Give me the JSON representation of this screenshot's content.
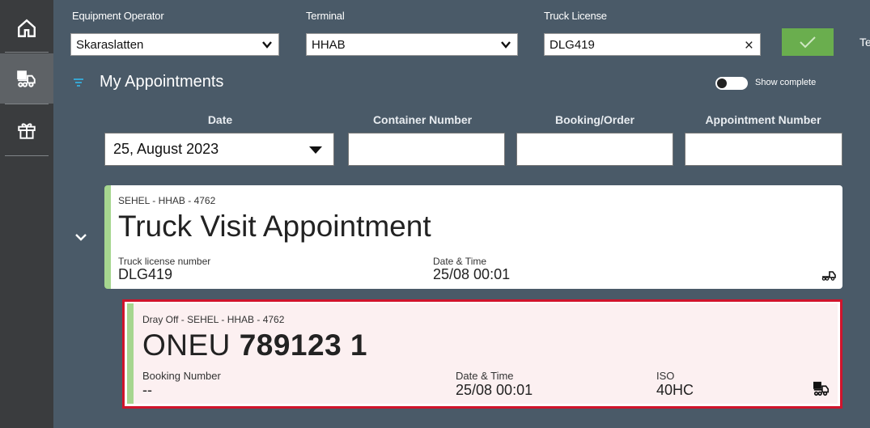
{
  "sidebar": {
    "items": [
      {
        "icon": "home-icon"
      },
      {
        "icon": "truck-loader-icon",
        "active": true
      },
      {
        "icon": "gift-icon"
      }
    ]
  },
  "filters": {
    "operator_label": "Equipment Operator",
    "operator_value": "Skaraslatten",
    "terminal_label": "Terminal",
    "terminal_value": "HHAB",
    "license_label": "Truck License",
    "license_value": "DLG419",
    "clear_symbol": "×",
    "truncated_text": "Te"
  },
  "appointments": {
    "title": "My Appointments",
    "show_complete_label": "Show complete",
    "show_complete_on": false,
    "columns": {
      "date": "Date",
      "container": "Container Number",
      "booking": "Booking/Order",
      "appointment": "Appointment Number"
    },
    "date_value": "25, August 2023",
    "container_value": "",
    "booking_value": "",
    "appointment_value": ""
  },
  "truck_visit": {
    "crumb": "SEHEL - HHAB - 4762",
    "title": "Truck Visit Appointment",
    "license_key": "Truck license number",
    "license_value": "DLG419",
    "datetime_key": "Date & Time",
    "datetime_value": "25/08 00:01",
    "icon": "truck-icon"
  },
  "container_appt": {
    "crumb": "Dray Off - SEHEL - HHAB - 4762",
    "prefix": "ONEU",
    "number": "789123 1",
    "booking_key": "Booking Number",
    "booking_value": "--",
    "datetime_key": "Date & Time",
    "datetime_value": "25/08 00:01",
    "iso_key": "ISO",
    "iso_value": "40HC",
    "icon": "truck-loader-icon"
  },
  "colors": {
    "background": "#4a5a68",
    "sidebar": "#3a3c3e",
    "accent_green": "#a6d68f",
    "confirm_green": "#6aae4e",
    "highlight_red": "#d0142c"
  }
}
